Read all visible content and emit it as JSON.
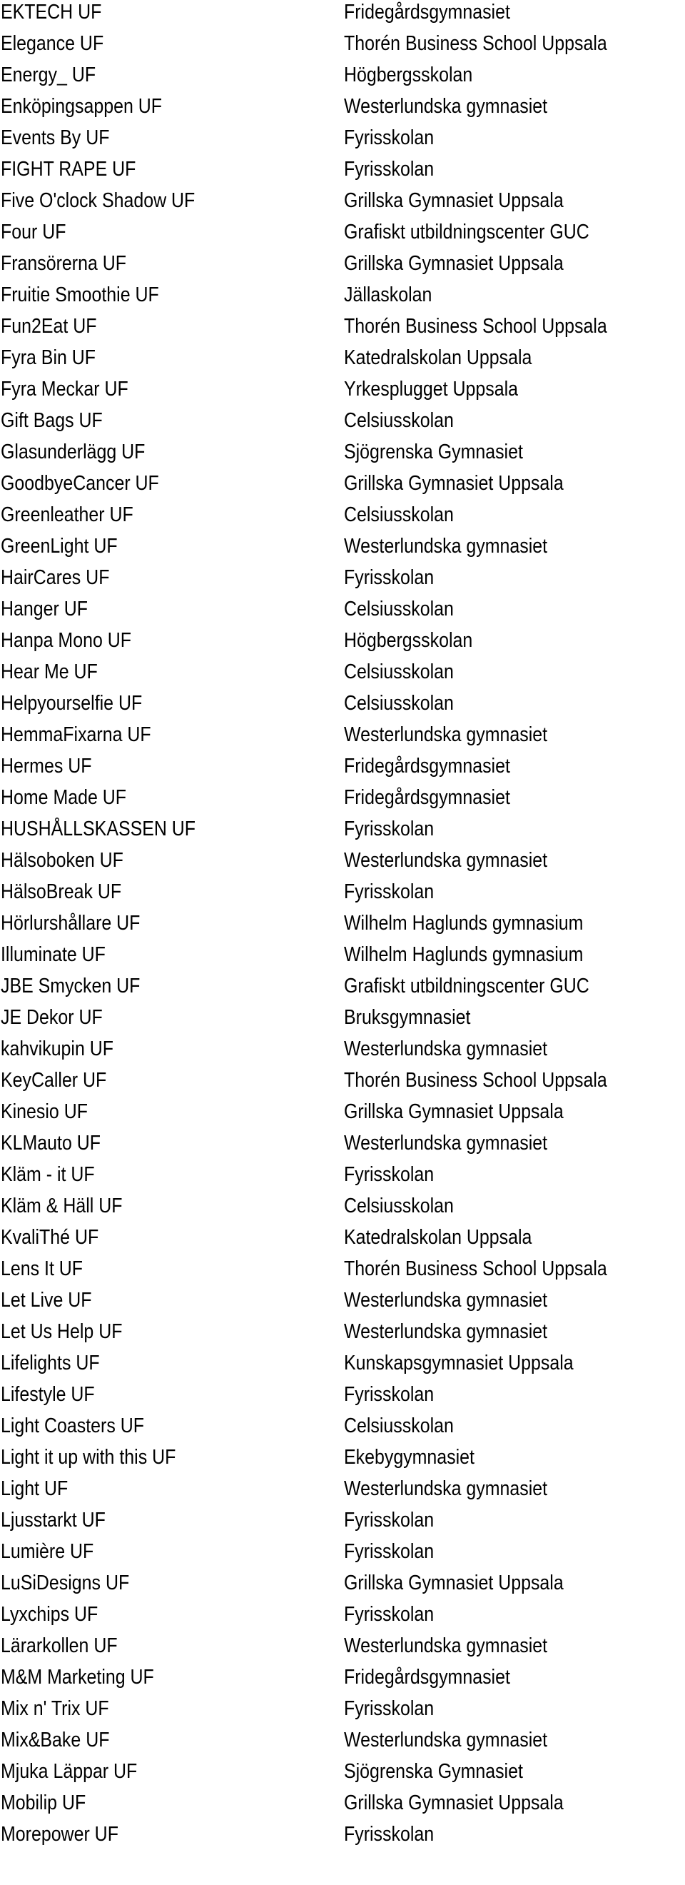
{
  "rows": [
    {
      "company": "EKTECH UF",
      "school": "Fridegårdsgymnasiet"
    },
    {
      "company": "Elegance UF",
      "school": "Thorén Business School Uppsala"
    },
    {
      "company": "Energy_ UF",
      "school": "Högbergsskolan"
    },
    {
      "company": "Enköpingsappen UF",
      "school": "Westerlundska gymnasiet"
    },
    {
      "company": "Events By UF",
      "school": "Fyrisskolan"
    },
    {
      "company": "FIGHT RAPE UF",
      "school": "Fyrisskolan"
    },
    {
      "company": "Five O'clock Shadow UF",
      "school": "Grillska Gymnasiet Uppsala"
    },
    {
      "company": "Four UF",
      "school": "Grafiskt utbildningscenter GUC"
    },
    {
      "company": "Fransörerna UF",
      "school": "Grillska Gymnasiet Uppsala"
    },
    {
      "company": "Fruitie Smoothie UF",
      "school": "Jällaskolan"
    },
    {
      "company": "Fun2Eat UF",
      "school": "Thorén Business School Uppsala"
    },
    {
      "company": "Fyra Bin UF",
      "school": "Katedralskolan Uppsala"
    },
    {
      "company": "Fyra Meckar UF",
      "school": "Yrkesplugget Uppsala"
    },
    {
      "company": "Gift Bags UF",
      "school": "Celsiusskolan"
    },
    {
      "company": "Glasunderlägg UF",
      "school": "Sjögrenska Gymnasiet"
    },
    {
      "company": "GoodbyeCancer UF",
      "school": "Grillska Gymnasiet Uppsala"
    },
    {
      "company": "Greenleather UF",
      "school": "Celsiusskolan"
    },
    {
      "company": "GreenLight UF",
      "school": "Westerlundska gymnasiet"
    },
    {
      "company": "HairCares UF",
      "school": "Fyrisskolan"
    },
    {
      "company": "Hanger UF",
      "school": "Celsiusskolan"
    },
    {
      "company": "Hanpa Mono UF",
      "school": "Högbergsskolan"
    },
    {
      "company": "Hear Me UF",
      "school": "Celsiusskolan"
    },
    {
      "company": "Helpyourselfie UF",
      "school": "Celsiusskolan"
    },
    {
      "company": "HemmaFixarna UF",
      "school": "Westerlundska gymnasiet"
    },
    {
      "company": "Hermes UF",
      "school": "Fridegårdsgymnasiet"
    },
    {
      "company": "Home Made UF",
      "school": "Fridegårdsgymnasiet"
    },
    {
      "company": "HUSHÅLLSKASSEN UF",
      "school": "Fyrisskolan"
    },
    {
      "company": "Hälsoboken UF",
      "school": "Westerlundska gymnasiet"
    },
    {
      "company": "HälsoBreak UF",
      "school": "Fyrisskolan"
    },
    {
      "company": "Hörlurshållare UF",
      "school": "Wilhelm Haglunds gymnasium"
    },
    {
      "company": "Illuminate UF",
      "school": "Wilhelm Haglunds gymnasium"
    },
    {
      "company": "JBE Smycken UF",
      "school": "Grafiskt utbildningscenter GUC"
    },
    {
      "company": "JE Dekor UF",
      "school": "Bruksgymnasiet"
    },
    {
      "company": "kahvikupin UF",
      "school": "Westerlundska gymnasiet"
    },
    {
      "company": "KeyCaller UF",
      "school": "Thorén Business School Uppsala"
    },
    {
      "company": "Kinesio UF",
      "school": "Grillska Gymnasiet Uppsala"
    },
    {
      "company": "KLMauto UF",
      "school": "Westerlundska gymnasiet"
    },
    {
      "company": "Kläm - it UF",
      "school": "Fyrisskolan"
    },
    {
      "company": "Kläm & Häll UF",
      "school": "Celsiusskolan"
    },
    {
      "company": "KvaliThé UF",
      "school": "Katedralskolan Uppsala"
    },
    {
      "company": "Lens It UF",
      "school": "Thorén Business School Uppsala"
    },
    {
      "company": "Let Live UF",
      "school": "Westerlundska gymnasiet"
    },
    {
      "company": "Let Us Help UF",
      "school": "Westerlundska gymnasiet"
    },
    {
      "company": "Lifelights UF",
      "school": "Kunskapsgymnasiet Uppsala"
    },
    {
      "company": "Lifestyle UF",
      "school": "Fyrisskolan"
    },
    {
      "company": "Light Coasters UF",
      "school": "Celsiusskolan"
    },
    {
      "company": "Light it up with this UF",
      "school": "Ekebygymnasiet"
    },
    {
      "company": "Light UF",
      "school": "Westerlundska gymnasiet"
    },
    {
      "company": "Ljusstarkt UF",
      "school": "Fyrisskolan"
    },
    {
      "company": "Lumière UF",
      "school": "Fyrisskolan"
    },
    {
      "company": "LuSiDesigns UF",
      "school": "Grillska Gymnasiet Uppsala"
    },
    {
      "company": "Lyxchips UF",
      "school": "Fyrisskolan"
    },
    {
      "company": "Lärarkollen UF",
      "school": "Westerlundska gymnasiet"
    },
    {
      "company": "M&M Marketing UF",
      "school": "Fridegårdsgymnasiet"
    },
    {
      "company": "Mix n' Trix UF",
      "school": "Fyrisskolan"
    },
    {
      "company": "Mix&Bake UF",
      "school": "Westerlundska gymnasiet"
    },
    {
      "company": "Mjuka Läppar UF",
      "school": "Sjögrenska Gymnasiet"
    },
    {
      "company": "Mobilip UF",
      "school": "Grillska Gymnasiet Uppsala"
    },
    {
      "company": "Morepower UF",
      "school": "Fyrisskolan"
    }
  ]
}
